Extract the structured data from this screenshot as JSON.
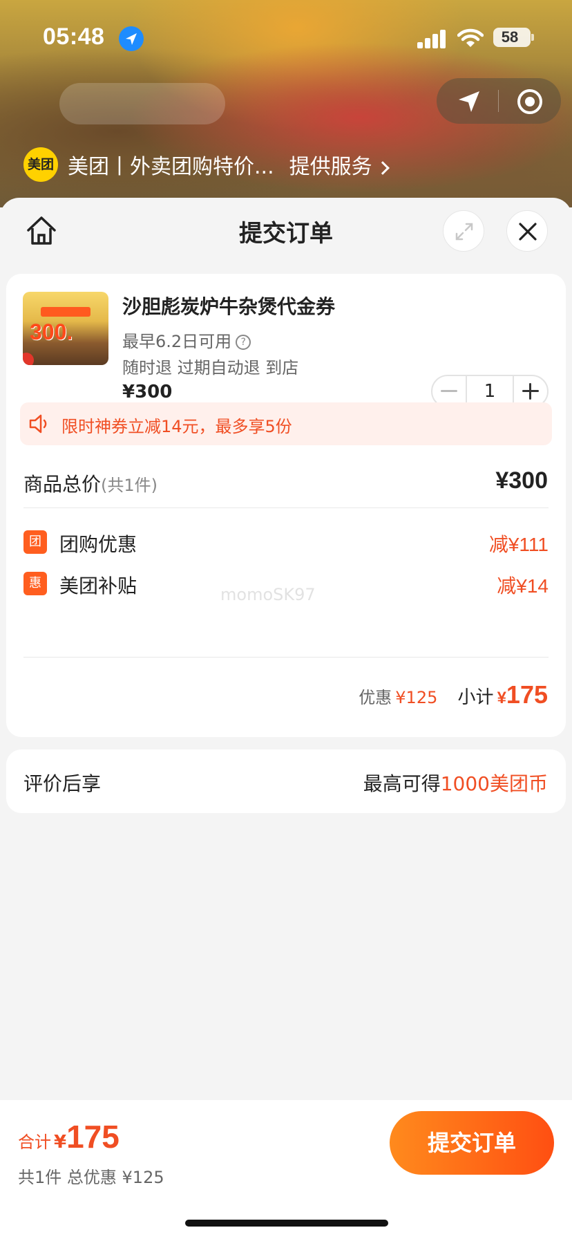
{
  "status_bar": {
    "time": "05:48",
    "battery": "58"
  },
  "mini_program": {
    "logo_text": "美团",
    "name": "美团丨外卖团购特价...",
    "service_link": "提供服务"
  },
  "header": {
    "title": "提交订单"
  },
  "product": {
    "name": "沙胆彪炭炉牛杂煲代金券",
    "availability": "最早6.2日可用",
    "tags": "随时退 过期自动退 到店",
    "price": "¥300",
    "quantity": "1",
    "thumb_text": "300."
  },
  "promo": {
    "text": "限时神券立减14元，最多享5份"
  },
  "summary": {
    "total_label": "商品总价",
    "total_count": "(共1件)",
    "total_value": "¥300",
    "discounts": [
      {
        "badge": "团",
        "label": "团购优惠",
        "value": "减¥111"
      },
      {
        "badge": "惠",
        "label": "美团补贴",
        "value": "减¥14"
      }
    ],
    "discount_label": "优惠",
    "discount_value": "¥125",
    "subtotal_label": "小计",
    "subtotal_currency": "¥",
    "subtotal_value": "175"
  },
  "review": {
    "label": "评价后享",
    "prefix": "最高可得",
    "highlight": "1000美团币"
  },
  "watermark": "momoSK97",
  "bottom_bar": {
    "total_label": "合计",
    "currency": "¥",
    "total_value": "175",
    "summary": "共1件 总优惠 ¥125",
    "submit_label": "提交订单"
  },
  "colors": {
    "accent": "#f04e23",
    "brand_yellow": "#ffd100",
    "button_start": "#ff8a1d",
    "button_end": "#ff4f12"
  }
}
